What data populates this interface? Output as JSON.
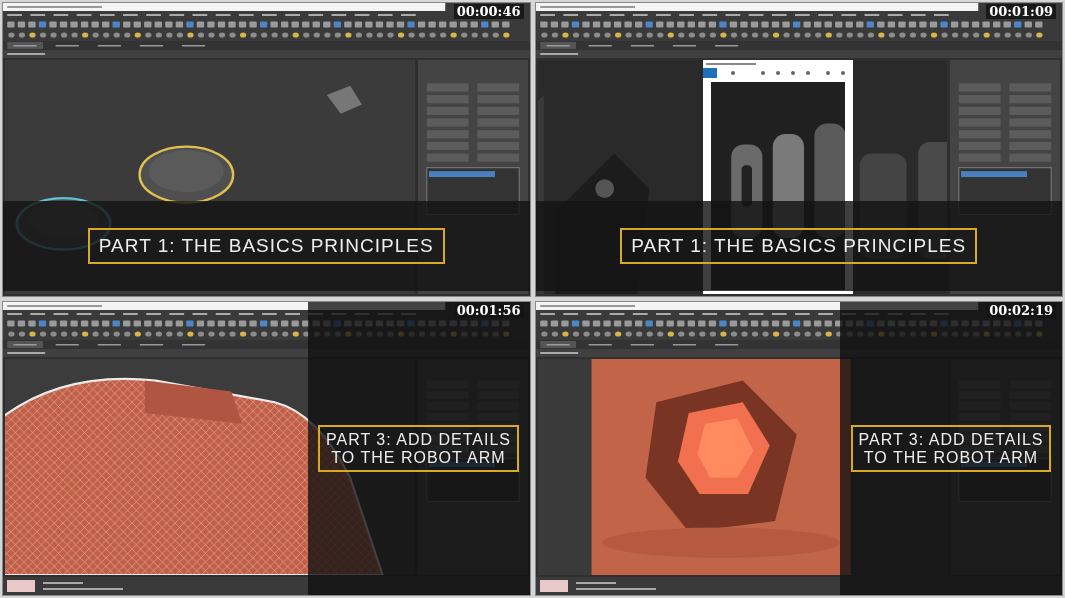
{
  "tiles": [
    {
      "timestamp": "00:00:46",
      "caption": {
        "kind": "band",
        "lines": [
          "PART 1: THE BASICS PRINCIPLES"
        ]
      }
    },
    {
      "timestamp": "00:01:09",
      "caption": {
        "kind": "band",
        "lines": [
          "PART 1: THE BASICS PRINCIPLES"
        ]
      }
    },
    {
      "timestamp": "00:01:56",
      "status": true,
      "caption": {
        "kind": "side",
        "lines": [
          "PART 3: ADD DETAILS",
          "TO THE ROBOT ARM"
        ]
      }
    },
    {
      "timestamp": "00:02:19",
      "status": true,
      "caption": {
        "kind": "side",
        "lines": [
          "PART 3: ADD DETAILS",
          "TO THE ROBOT ARM"
        ]
      }
    }
  ]
}
